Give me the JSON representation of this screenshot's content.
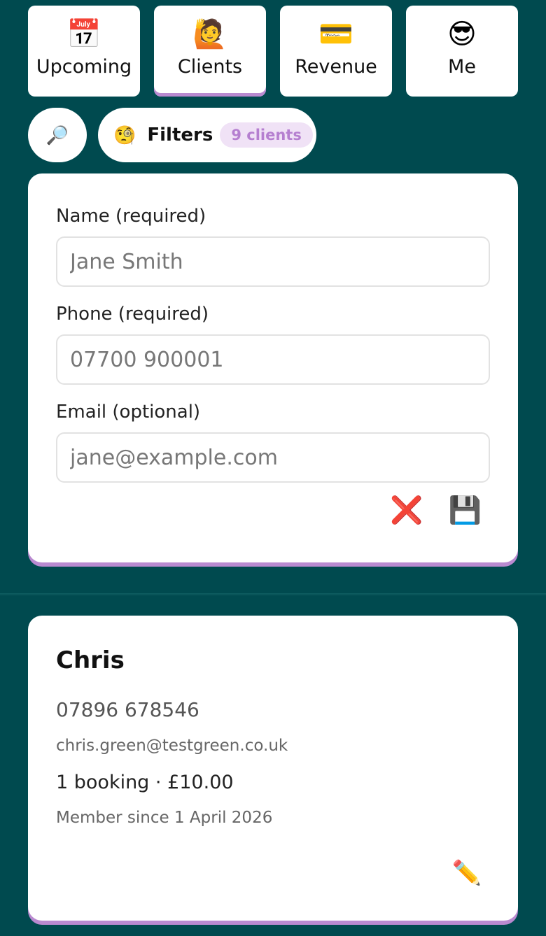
{
  "tabs": [
    {
      "icon": "📅",
      "label": "Upcoming"
    },
    {
      "icon": "🙋",
      "label": "Clients"
    },
    {
      "icon": "💳",
      "label": "Revenue"
    },
    {
      "icon": "😎",
      "label": "Me"
    }
  ],
  "toolbar": {
    "search_icon": "🔎",
    "filters_icon": "🧐",
    "filters_label": "Filters",
    "client_count": "9 clients"
  },
  "form": {
    "name_label": "Name (required)",
    "name_placeholder": "Jane Smith",
    "phone_label": "Phone (required)",
    "phone_placeholder": "07700 900001",
    "email_label": "Email (optional)",
    "email_placeholder": "jane@example.com",
    "cancel_icon": "❌",
    "save_icon": "💾"
  },
  "client": {
    "name": "Chris",
    "phone": "07896 678546",
    "email": "chris.green@testgreen.co.uk",
    "bookings": "1 booking · £10.00",
    "member_since": "Member since 1 April 2026",
    "edit_icon": "✏️"
  }
}
